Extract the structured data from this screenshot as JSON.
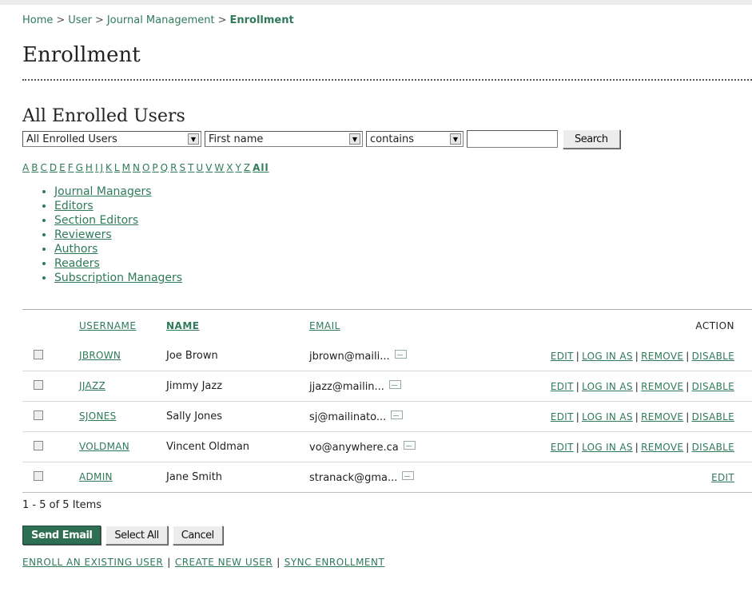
{
  "breadcrumb": {
    "items": [
      "Home",
      "User",
      "Journal Management"
    ],
    "separator": ">",
    "current": "Enrollment"
  },
  "page_title": "Enrollment",
  "section_title": "All Enrolled Users",
  "filters": {
    "role_select": "All Enrolled Users",
    "field_select": "First name",
    "match_select": "contains",
    "search_value": "",
    "search_button": "Search"
  },
  "alphabet": [
    "A",
    "B",
    "C",
    "D",
    "E",
    "F",
    "G",
    "H",
    "I",
    "J",
    "K",
    "L",
    "M",
    "N",
    "O",
    "P",
    "Q",
    "R",
    "S",
    "T",
    "U",
    "V",
    "W",
    "X",
    "Y",
    "Z"
  ],
  "alphabet_all": "All",
  "roles": [
    "Journal Managers",
    "Editors",
    "Section Editors",
    "Reviewers",
    "Authors",
    "Readers",
    "Subscription Managers"
  ],
  "table": {
    "headers": {
      "username": "USERNAME",
      "name": "NAME",
      "email": "EMAIL",
      "action": "ACTION"
    },
    "rows": [
      {
        "username": "JBROWN",
        "name": "Joe Brown",
        "email": "jbrown@maili...",
        "actions": [
          "EDIT",
          "LOG IN AS",
          "REMOVE",
          "DISABLE"
        ]
      },
      {
        "username": "JJAZZ",
        "name": "Jimmy Jazz",
        "email": "jjazz@mailin...",
        "actions": [
          "EDIT",
          "LOG IN AS",
          "REMOVE",
          "DISABLE"
        ]
      },
      {
        "username": "SJONES",
        "name": "Sally Jones",
        "email": "sj@mailinato...",
        "actions": [
          "EDIT",
          "LOG IN AS",
          "REMOVE",
          "DISABLE"
        ]
      },
      {
        "username": "VOLDMAN",
        "name": "Vincent Oldman",
        "email": "vo@anywhere.ca",
        "actions": [
          "EDIT",
          "LOG IN AS",
          "REMOVE",
          "DISABLE"
        ]
      },
      {
        "username": "ADMIN",
        "name": "Jane Smith",
        "email": "stranack@gma...",
        "actions": [
          "EDIT"
        ]
      }
    ]
  },
  "item_count": "1 - 5 of 5 Items",
  "buttons": {
    "send_email": "Send Email",
    "select_all": "Select All",
    "cancel": "Cancel"
  },
  "footer_links": [
    "ENROLL AN EXISTING USER",
    "CREATE NEW USER",
    "SYNC ENROLLMENT"
  ],
  "colors": {
    "link": "#2f7a5b",
    "primary_button": "#2e6e53"
  }
}
